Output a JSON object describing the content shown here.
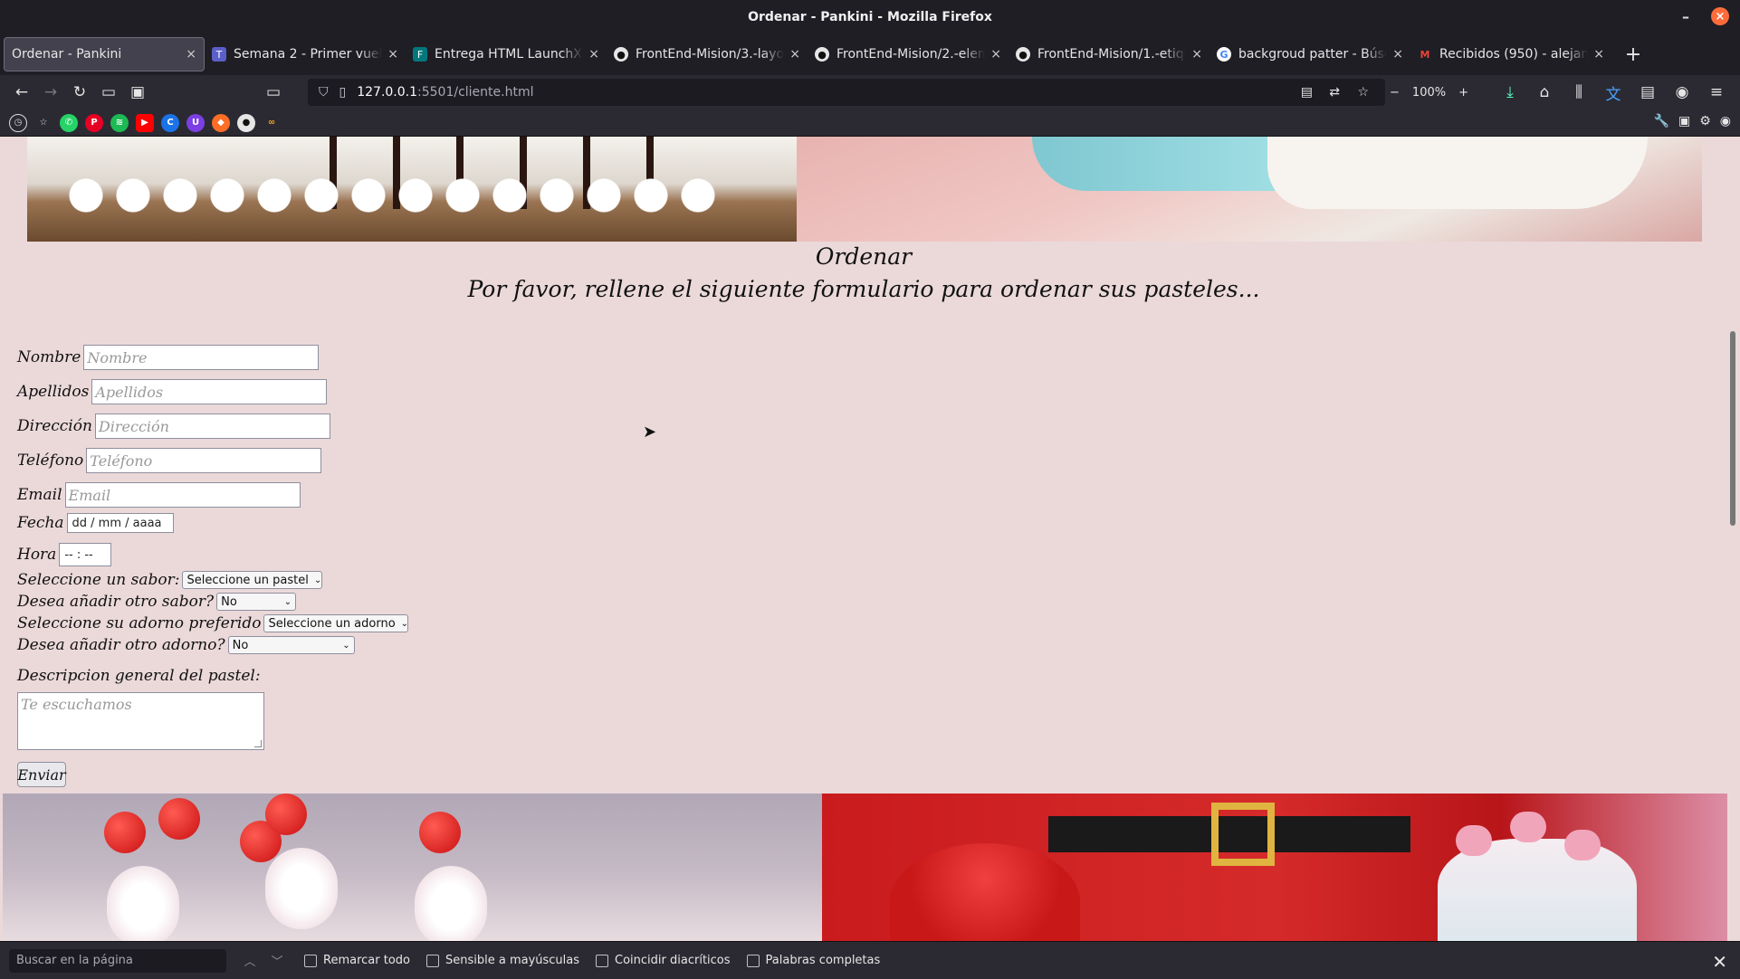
{
  "window": {
    "title": "Ordenar - Pankini - Mozilla Firefox",
    "minimize": "–",
    "close": "×"
  },
  "tabs": [
    {
      "label": "Ordenar - Pankini",
      "icon": "blank-page-icon",
      "active": true
    },
    {
      "label": "Semana 2 - Primer vuelo 🎓 ✈️",
      "icon": "teams-icon",
      "active": false
    },
    {
      "label": "Entrega HTML LaunchX",
      "icon": "forms-icon",
      "active": false
    },
    {
      "label": "FrontEnd-Mision/3.-layoutY",
      "icon": "github-icon",
      "active": false
    },
    {
      "label": "FrontEnd-Mision/2.-element",
      "icon": "github-icon",
      "active": false
    },
    {
      "label": "FrontEnd-Mision/1.-etiqueta",
      "icon": "github-icon",
      "active": false
    },
    {
      "label": "backgroud patter - Búsqued",
      "icon": "google-icon",
      "active": false
    },
    {
      "label": "Recibidos (950) - alejandro",
      "icon": "gmail-icon",
      "active": false
    }
  ],
  "tab_close": "×",
  "new_tab": "+",
  "nav": {
    "url_host": "127.0.0.1",
    "url_rest": ":5501/cliente.html",
    "zoom": "100%",
    "zoom_out": "−",
    "zoom_in": "+"
  },
  "page": {
    "heading": "Ordenar",
    "subheading": "Por favor, rellene el siguiente formulario para ordenar sus pasteles...",
    "form": {
      "nombre_label": "Nombre",
      "nombre_placeholder": "Nombre",
      "apellidos_label": "Apellidos",
      "apellidos_placeholder": "Apellidos",
      "direccion_label": "Dirección",
      "direccion_placeholder": "Dirección",
      "telefono_label": "Teléfono",
      "telefono_placeholder": "Teléfono",
      "email_label": "Email",
      "email_placeholder": "Email",
      "fecha_label": "Fecha",
      "fecha_value": "dd / mm / aaaa",
      "hora_label": "Hora",
      "hora_value": "-- : --",
      "sabor_label": "Seleccione un sabor:",
      "sabor_value": "Seleccione un pastel",
      "otro_sabor_label": "Desea añadir otro sabor?",
      "otro_sabor_value": "No",
      "adorno_label": "Seleccione su adorno preferido",
      "adorno_value": "Seleccione un adorno",
      "otro_adorno_label": "Desea añadir otro adorno?",
      "otro_adorno_value": "No",
      "descripcion_label": "Descripcion general del pastel:",
      "descripcion_placeholder": "Te escuchamos",
      "submit_label": "Enviar"
    }
  },
  "findbar": {
    "placeholder": "Buscar en la página",
    "options": [
      "Remarcar todo",
      "Sensible a mayúsculas",
      "Coincidir diacríticos",
      "Palabras completas"
    ]
  }
}
